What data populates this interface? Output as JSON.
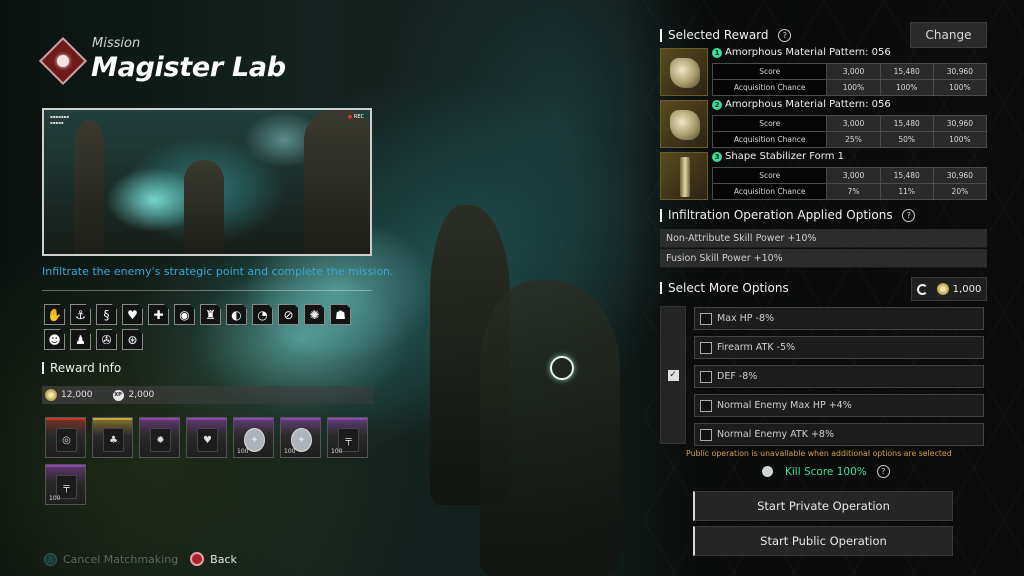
{
  "mission": {
    "label": "Mission",
    "title": "Magister Lab",
    "emblem_icon": "mission-emblem-icon",
    "description": "Infiltrate the enemy's strategic point and complete the mission.",
    "preview": {
      "rec_label": "REC"
    }
  },
  "modifier_icons": [
    "shield-hand",
    "anchor",
    "serpent",
    "heart-splash",
    "medkit",
    "target-ring",
    "beacon",
    "planet",
    "searching-eye",
    "no-entry",
    "sparkle",
    "crowd",
    "mask",
    "figures",
    "radiation",
    "nuclear"
  ],
  "reward_info": {
    "title": "Reward Info",
    "gold": "12,000",
    "xp_label": "XP",
    "xp": "2,000",
    "items": [
      {
        "name": "red-module",
        "rarity_color": "#c0392b",
        "glyph": "◎",
        "qty": ""
      },
      {
        "name": "gold-module",
        "rarity_color": "#c9a83a",
        "glyph": "♣",
        "qty": ""
      },
      {
        "name": "purple-module-gear",
        "rarity_color": "#8e44ad",
        "glyph": "✹",
        "qty": ""
      },
      {
        "name": "purple-module-heart",
        "rarity_color": "#8e44ad",
        "glyph": "♥",
        "qty": ""
      },
      {
        "name": "crystal-blue",
        "rarity_color": "#8e44ad",
        "glyph": "✦",
        "qty": "100"
      },
      {
        "name": "crystal-green",
        "rarity_color": "#8e44ad",
        "glyph": "✦",
        "qty": "100"
      },
      {
        "name": "rifle",
        "rarity_color": "#8e44ad",
        "glyph": "╤",
        "qty": "100"
      },
      {
        "name": "shotgun",
        "rarity_color": "#8e44ad",
        "glyph": "╤",
        "qty": "100"
      }
    ]
  },
  "footer": {
    "cancel_label": "Cancel Matchmaking",
    "back_label": "Back"
  },
  "selected_reward": {
    "title": "Selected Reward",
    "change_label": "Change",
    "score_label": "Score",
    "chance_label": "Acquisition Chance",
    "entries": [
      {
        "num": "1",
        "name": "Amorphous Material Pattern: 056",
        "scores": [
          "3,000",
          "15,480",
          "30,960"
        ],
        "chances": [
          "100%",
          "100%",
          "100%"
        ]
      },
      {
        "num": "2",
        "name": "Amorphous Material Pattern: 056",
        "scores": [
          "3,000",
          "15,480",
          "30,960"
        ],
        "chances": [
          "25%",
          "50%",
          "100%"
        ]
      },
      {
        "num": "3",
        "name": "Shape Stabilizer Form 1",
        "scores": [
          "3,000",
          "15,480",
          "30,960"
        ],
        "chances": [
          "7%",
          "11%",
          "20%"
        ]
      }
    ]
  },
  "applied_options": {
    "title": "Infiltration Operation Applied Options",
    "items": [
      "Non-Attribute Skill Power +10%",
      "Fusion Skill Power +10%"
    ]
  },
  "more_options": {
    "title": "Select More Options",
    "cost": "1,000",
    "items": [
      {
        "label": "Max HP -8%",
        "checked": false
      },
      {
        "label": "Firearm ATK -5%",
        "checked": false
      },
      {
        "label": "DEF -8%",
        "checked": false
      },
      {
        "label": "Normal Enemy Max HP +4%",
        "checked": false
      },
      {
        "label": "Normal Enemy ATK +8%",
        "checked": false
      }
    ]
  },
  "warning": "Public operation is unavailable when additional options are selected",
  "kill_score": "Kill Score 100%",
  "buttons": {
    "private": "Start Private Operation",
    "public": "Start Public Operation"
  },
  "colors": {
    "accent_green": "#3ddc97",
    "warning": "#d3a04c",
    "description_blue": "#3aa6d8",
    "frame_orange": "#e07a45"
  }
}
